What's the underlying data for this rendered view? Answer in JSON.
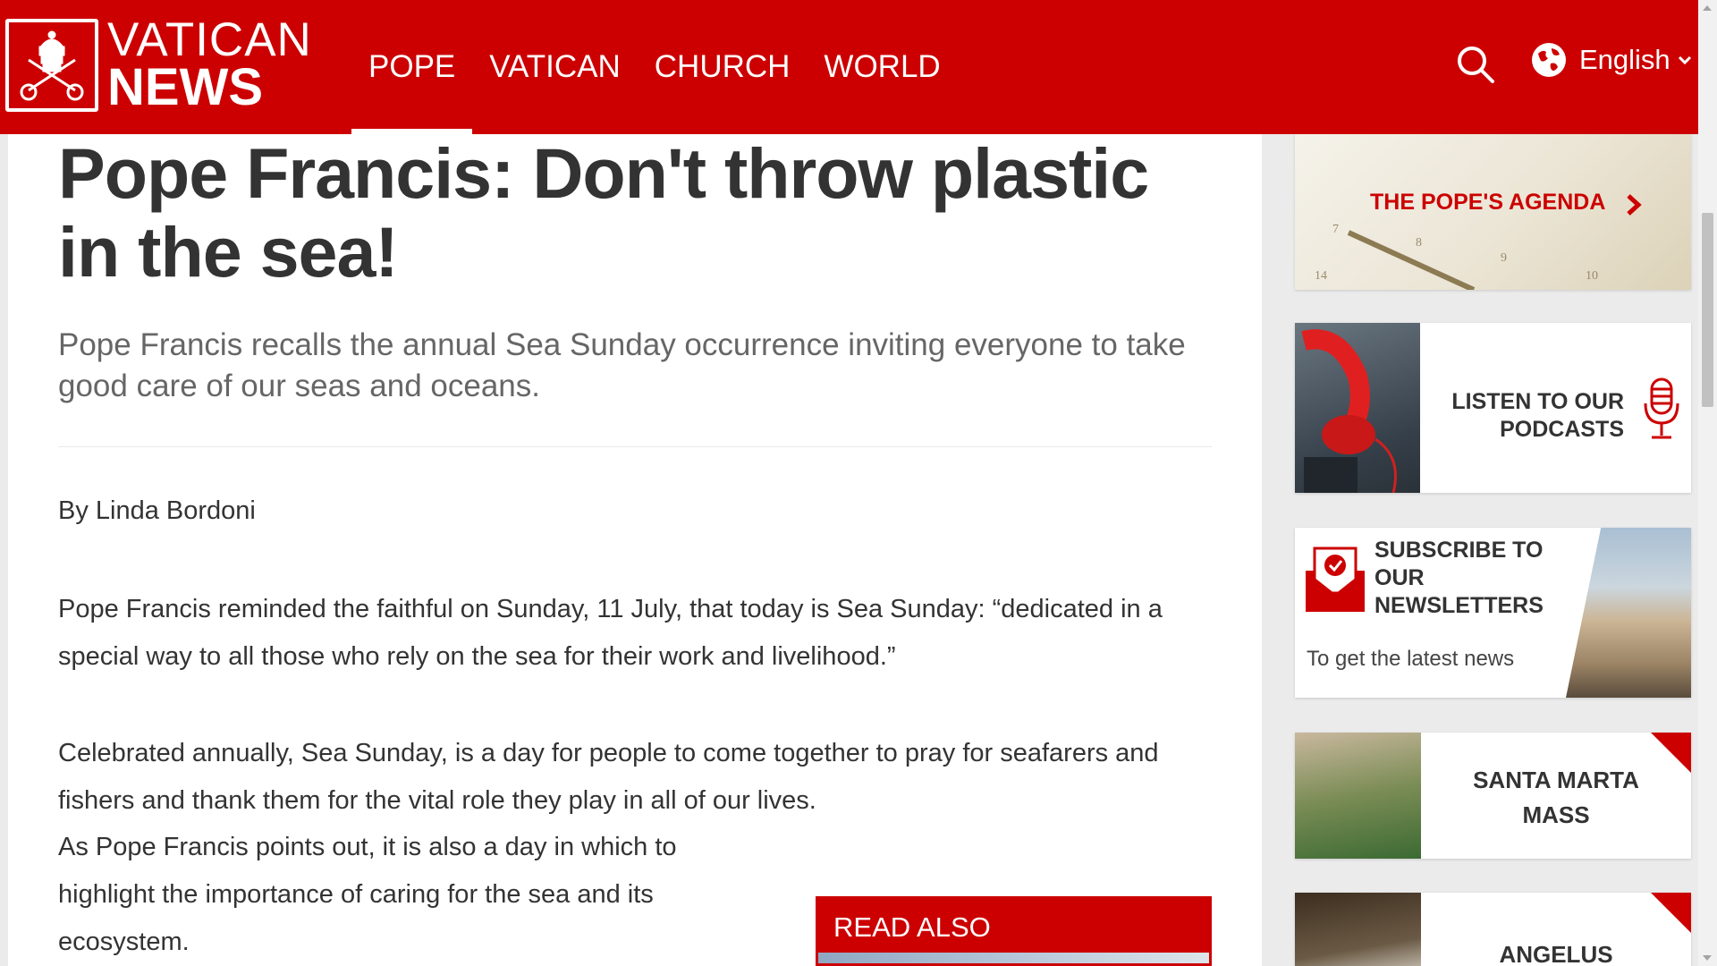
{
  "brand": {
    "line1": "VATICAN",
    "line2": "NEWS",
    "red": "#cc0000"
  },
  "nav": {
    "items": [
      {
        "label": "POPE",
        "active": true
      },
      {
        "label": "VATICAN",
        "active": false
      },
      {
        "label": "CHURCH",
        "active": false
      },
      {
        "label": "WORLD",
        "active": false
      }
    ]
  },
  "header": {
    "search_icon": "search-icon",
    "globe_icon": "globe-icon",
    "language": "English"
  },
  "article": {
    "title": "Pope Francis: Don't throw plastic in the sea!",
    "subtitle": "Pope Francis recalls the annual Sea Sunday occurrence inviting everyone to take good care of our seas and oceans.",
    "byline": "By Linda Bordoni",
    "paragraphs": [
      "Pope Francis reminded the faithful on Sunday, 11 July, that today is Sea Sunday: “dedicated in a special way to all those who rely on the sea for their work and livelihood.”",
      "Celebrated annually, Sea Sunday, is a day for people to come together to pray for seafarers and fishers and thank them for the vital role they play in all of our lives.",
      "As Pope Francis points out, it is also a day in which to highlight the importance of caring for the sea and its ecosystem."
    ],
    "read_also": "READ ALSO"
  },
  "sidebar": {
    "agenda": "THE POPE'S AGENDA",
    "podcasts_line1": "LISTEN TO OUR",
    "podcasts_line2": "PODCASTS",
    "newsletter_title_1": "SUBSCRIBE TO",
    "newsletter_title_2": "OUR",
    "newsletter_title_3": "NEWSLETTERS",
    "newsletter_sub": "To get the latest news",
    "mass_line1": "SANTA MARTA",
    "mass_line2": "MASS",
    "angelus": "ANGELUS"
  }
}
